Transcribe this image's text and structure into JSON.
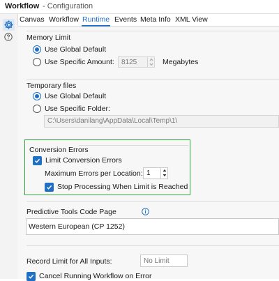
{
  "titlebar": {
    "app": "Workflow",
    "subtitle": "- Configuration"
  },
  "sidebar": {
    "gear_icon": "gear-icon",
    "help_icon": "help-circle-icon"
  },
  "tabs": [
    {
      "label": "Canvas"
    },
    {
      "label": "Workflow"
    },
    {
      "label": "Runtime",
      "active": true
    },
    {
      "label": "Events"
    },
    {
      "label": "Meta Info"
    },
    {
      "label": "XML View"
    }
  ],
  "memory": {
    "heading": "Memory Limit",
    "use_global": "Use Global Default",
    "use_specific": "Use Specific Amount:",
    "amount_value": "8125",
    "unit": "Megabytes"
  },
  "temp": {
    "heading": "Temporary files",
    "use_global": "Use Global Default",
    "use_specific": "Use Specific Folder:",
    "folder_value": "C:\\Users\\danilang\\AppData\\Local\\Temp\\1\\"
  },
  "conversion": {
    "heading": "Conversion Errors",
    "limit_label": "Limit Conversion Errors",
    "max_label": "Maximum Errors per Location:",
    "max_value": "1",
    "stop_label": "Stop Processing When Limit is Reached"
  },
  "predictive": {
    "heading": "Predictive Tools Code Page",
    "value": "Western European (CP 1252)"
  },
  "record_limit": {
    "label": "Record Limit for All Inputs:",
    "placeholder": "No Limit"
  },
  "cancel": {
    "label": "Cancel Running Workflow on Error"
  },
  "colors": {
    "accent": "#1f6fc5",
    "highlight": "#2ea43a"
  }
}
